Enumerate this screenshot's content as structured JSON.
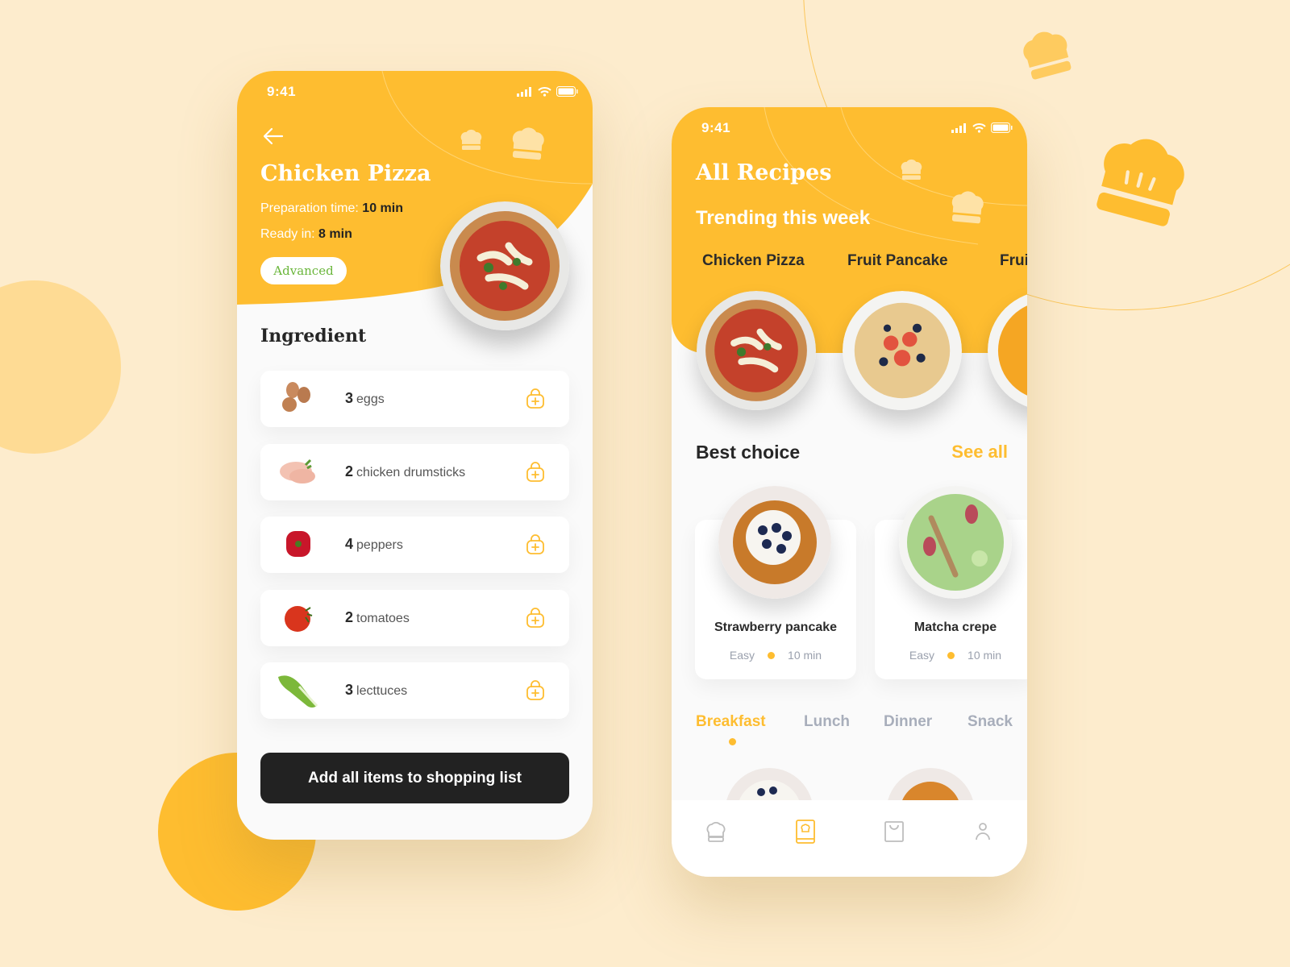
{
  "colors": {
    "accent": "#febd30",
    "background": "#fdeccd",
    "dark": "#222222",
    "badge_text": "#6ab63b",
    "muted": "#a8aebb"
  },
  "detail_screen": {
    "status_time": "9:41",
    "title": "Chicken Pizza",
    "prep_label": "Preparation time:",
    "prep_value": "10 min",
    "ready_label": "Ready in:",
    "ready_value": "8 min",
    "difficulty_badge": "Advanced",
    "section_title": "Ingredient",
    "ingredients": [
      {
        "qty": "3",
        "name": "eggs",
        "icon": "eggs"
      },
      {
        "qty": "2",
        "name": "chicken drumsticks",
        "icon": "chicken-drumstick"
      },
      {
        "qty": "4",
        "name": "peppers",
        "icon": "pepper"
      },
      {
        "qty": "2",
        "name": "tomatoes",
        "icon": "tomato"
      },
      {
        "qty": "3",
        "name": "lecttuces",
        "icon": "lettuce"
      }
    ],
    "primary_button": "Add all items to shopping list"
  },
  "recipes_screen": {
    "status_time": "9:41",
    "title": "All Recipes",
    "subtitle": "Trending this week",
    "trending": [
      "Chicken Pizza",
      "Fruit Pancake",
      "Frui"
    ],
    "best_choice_title": "Best choice",
    "see_all": "See all",
    "cards": [
      {
        "name": "Strawberry pancake",
        "difficulty": "Easy",
        "time": "10 min"
      },
      {
        "name": "Matcha crepe",
        "difficulty": "Easy",
        "time": "10 min"
      }
    ],
    "meal_tabs": [
      {
        "label": "Breakfast",
        "active": true
      },
      {
        "label": "Lunch",
        "active": false
      },
      {
        "label": "Dinner",
        "active": false
      },
      {
        "label": "Snack",
        "active": false
      }
    ],
    "tabbar": [
      "chef-hat",
      "recipe-book",
      "shopping-bag",
      "profile"
    ],
    "active_tab": "recipe-book"
  }
}
